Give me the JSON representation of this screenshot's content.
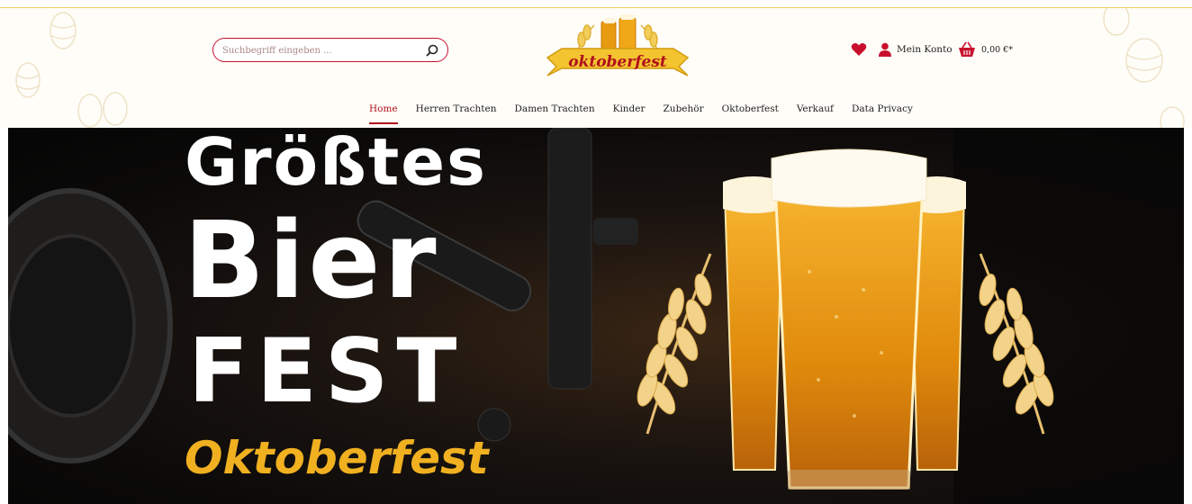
{
  "header": {
    "search": {
      "placeholder": "Suchbegriff eingeben ...",
      "value": "",
      "icon": "search-icon"
    },
    "logo": {
      "text": "oktoberfest"
    },
    "wishlist": {
      "icon": "heart-icon"
    },
    "account": {
      "icon": "user-icon",
      "label": "Mein Konto"
    },
    "cart": {
      "icon": "basket-icon",
      "total": "0,00 €*"
    }
  },
  "nav": {
    "items": [
      {
        "label": "Home",
        "active": true
      },
      {
        "label": "Herren Trachten"
      },
      {
        "label": "Damen Trachten"
      },
      {
        "label": "Kinder"
      },
      {
        "label": "Zubehör"
      },
      {
        "label": "Oktoberfest"
      },
      {
        "label": "Verkauf"
      },
      {
        "label": "Data Privacy"
      }
    ]
  },
  "banner": {
    "line1": "Größtes",
    "line2": "Bier",
    "line3": "FEST",
    "line4": "Oktoberfest"
  },
  "colors": {
    "accent": "#b0101c",
    "gold": "#f0b020",
    "beer": "#e89a10"
  }
}
